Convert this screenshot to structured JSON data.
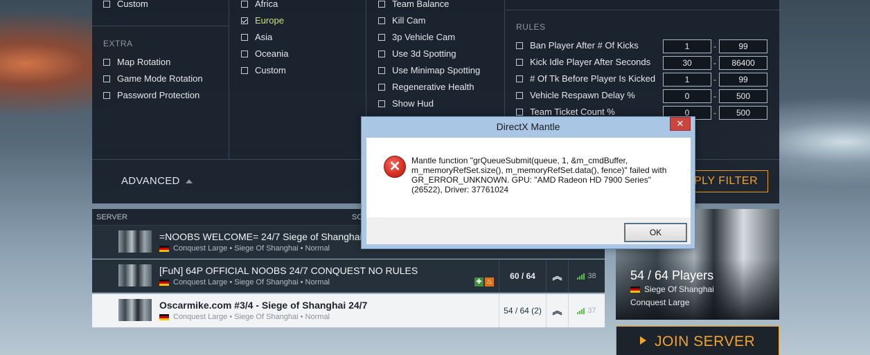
{
  "filters": {
    "col1_top": {
      "label": "Custom",
      "checked": false
    },
    "extra": {
      "header": "EXTRA",
      "items": [
        {
          "label": "Map Rotation"
        },
        {
          "label": "Game Mode Rotation"
        },
        {
          "label": "Password Protection"
        }
      ]
    },
    "regions": [
      {
        "label": "Africa",
        "checked": false
      },
      {
        "label": "Europe",
        "checked": true
      },
      {
        "label": "Asia",
        "checked": false
      },
      {
        "label": "Oceania",
        "checked": false
      },
      {
        "label": "Custom",
        "checked": false
      }
    ],
    "settings": [
      {
        "label": "Team Balance"
      },
      {
        "label": "Kill Cam"
      },
      {
        "label": "3p Vehicle Cam"
      },
      {
        "label": "Use 3d Spotting"
      },
      {
        "label": "Use Minimap Spotting"
      },
      {
        "label": "Regenerative Health"
      },
      {
        "label": "Show Hud"
      }
    ],
    "rules": {
      "header": "RULES",
      "items": [
        {
          "label": "Ban Player After # Of Kicks",
          "min": "1",
          "max": "99"
        },
        {
          "label": "Kick Idle Player After Seconds",
          "min": "30",
          "max": "86400"
        },
        {
          "label": "# Of Tk Before Player Is Kicked",
          "min": "1",
          "max": "99"
        },
        {
          "label": "Vehicle Respawn Delay %",
          "min": "0",
          "max": "500"
        },
        {
          "label": "Team Ticket Count %",
          "min": "0",
          "max": "500"
        }
      ],
      "separator": "-"
    }
  },
  "advanced_label": "ADVANCED",
  "apply_filter_label": "PLY FILTER",
  "server_list": {
    "headers": {
      "server": "SERVER",
      "truncated": "SC"
    },
    "rows": [
      {
        "name": "=NOOBS WELCOME= 24/7 Siege of Shanghai",
        "sub": "Conquest Large • Siege Of Shanghai • Normal"
      },
      {
        "name": "[FuN] 64P OFFICIAL NOOBS 24/7 CONQUEST NO RULES",
        "sub": "Conquest Large • Siege Of Shanghai • Normal",
        "players": "60 / 64",
        "ping": "38"
      },
      {
        "name": "Oscarmike.com #3/4 - Siege of Shanghai 24/7",
        "sub": "Conquest Large • Siege Of Shanghai • Normal",
        "players": "54 / 64 (2)",
        "ping": "37"
      }
    ]
  },
  "preview": {
    "players": "54 / 64 Players",
    "map": "Siege Of Shanghai",
    "mode": "Conquest Large"
  },
  "join_label": "JOIN SERVER",
  "dialog": {
    "title": "DirectX Mantle",
    "close": "✕",
    "message": "Mantle function \"grQueueSubmit(queue, 1, &m_cmdBuffer, m_memoryRefSet.size(), m_memoryRefSet.data(), fence)\" failed with GR_ERROR_UNKNOWN. GPU: \"AMD Radeon HD 7900 Series\" (26522), Driver: 37761024",
    "ok": "OK",
    "error_glyph": "✕"
  },
  "colors": {
    "accent": "#f3a32a",
    "selected": "#c8e27a",
    "ping": "#5fc24a"
  }
}
